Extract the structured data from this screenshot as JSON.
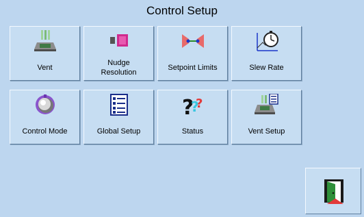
{
  "header": {
    "title": "Control Setup"
  },
  "tiles": [
    {
      "label": "Vent",
      "icon": "vent-icon"
    },
    {
      "label": "Nudge\nResolution",
      "icon": "nudge-resolution-icon"
    },
    {
      "label": "Setpoint Limits",
      "icon": "setpoint-limits-icon"
    },
    {
      "label": "Slew Rate",
      "icon": "slew-rate-icon"
    },
    {
      "label": "Control Mode",
      "icon": "control-mode-knob-icon"
    },
    {
      "label": "Global Setup",
      "icon": "checklist-icon"
    },
    {
      "label": "Status",
      "icon": "question-marks-icon"
    },
    {
      "label": "Vent Setup",
      "icon": "vent-setup-icon"
    }
  ],
  "exit": {
    "icon": "exit-door-icon"
  }
}
